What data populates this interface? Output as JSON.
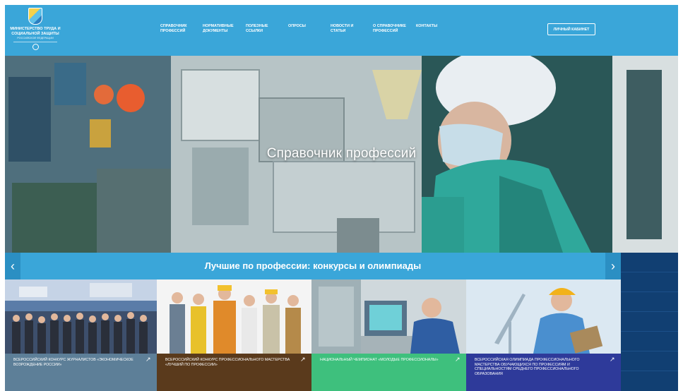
{
  "header": {
    "logo": {
      "line1": "МИНИСТЕРСТВО ТРУДА И",
      "line2": "СОЦИАЛЬНОЙ ЗАЩИТЫ",
      "line3": "РОССИЙСКОЙ ФЕДЕРАЦИИ"
    },
    "nav": [
      {
        "label": "СПРАВОЧНИК ПРОФЕССИЙ"
      },
      {
        "label": "НОРМАТИВНЫЕ ДОКУМЕНТЫ"
      },
      {
        "label": "ПОЛЕЗНЫЕ ССЫЛКИ"
      },
      {
        "label": "ОПРОСЫ"
      },
      {
        "label": "НОВОСТИ И СТАТЬИ"
      },
      {
        "label": "О СПРАВОЧНИКЕ ПРОФЕССИЙ"
      },
      {
        "label": "КОНТАКТЫ"
      }
    ],
    "cabinet_label": "ЛИЧНЫЙ КАБИНЕТ"
  },
  "hero": {
    "title": "Справочник профессий"
  },
  "band": {
    "title": "Лучшие по профессии: конкурсы и олимпиады",
    "prev_icon": "‹",
    "next_icon": "›"
  },
  "cards": [
    {
      "caption": "ВСЕРОССИЙСКИЙ КОНКУРС ЖУРНАЛИСТОВ «ЭКОНОМИЧЕСКОЕ ВОЗРОЖДЕНИЕ РОССИИ»",
      "color": "#5d7f98"
    },
    {
      "caption": "ВСЕРОССИЙСКИЙ КОНКУРС ПРОФЕССИОНАЛЬНОГО МАСТЕРСТВА «ЛУЧШИЙ ПО ПРОФЕССИИ»",
      "color": "#5a3a1c"
    },
    {
      "caption": "НАЦИОНАЛЬНЫЙ ЧЕМПИОНАТ «МОЛОДЫЕ ПРОФЕССИОНАЛЫ»",
      "color": "#3ec07d"
    },
    {
      "caption": "ВСЕРОССИЙСКАЯ ОЛИМПИАДА ПРОФЕССИОНАЛЬНОГО МАСТЕРСТВА ОБУЧАЮЩИХСЯ ПО ПРОФЕССИЯМ И СПЕЦИАЛЬНОСТЯМ СРЕДНЕГО ПРОФЕССИОНАЛЬНОГО ОБРАЗОВАНИЯ",
      "color": "#2e3a9a"
    }
  ],
  "colors": {
    "header": "#3aa6d9",
    "band": "#3aa6d9",
    "sidebar": "#113f72"
  },
  "icons": {
    "card_link": "↗",
    "logo": "emblem-icon",
    "seal": "coat-of-arms-icon"
  }
}
